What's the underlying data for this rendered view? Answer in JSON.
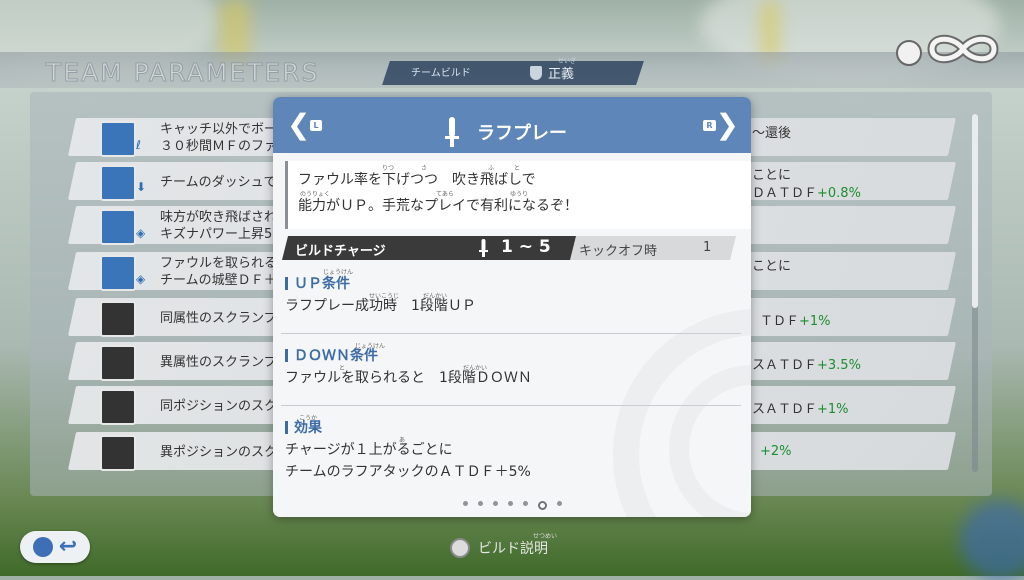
{
  "screen_title": "TEAM PARAMETERS",
  "tabs": {
    "build_tab": "チームビルド",
    "active_tab": "正義",
    "active_tab_ruby": "せいぎ"
  },
  "stat_rows": [
    {
      "text1": "キャッチ以外でボー",
      "text2": "３０秒間ＭＦのファ",
      "right": "〜還後",
      "right_green": ""
    },
    {
      "text1": "チームのダッシュで",
      "text2": "",
      "right": "ことに",
      "right2": "ＤＡＴＤＦ",
      "right_green": "+0.8%"
    },
    {
      "text1": "味方が吹き飛ばされ",
      "text2": "キズナパワー上昇5",
      "right": "",
      "right_green": ""
    },
    {
      "text1": "ファウルを取られる",
      "text2": "チームの城壁ＤＦ＋",
      "right": "ことに",
      "right_green": ""
    },
    {
      "text1": "同属性のスクランブ",
      "text2": "",
      "right": "ＴＤＦ",
      "right_green": "+1%"
    },
    {
      "text1": "異属性のスクランブ",
      "text2": "",
      "right": "スＡＴＤＦ",
      "right_green": "+3.5%"
    },
    {
      "text1": "同ポジションのスク",
      "text2": "",
      "right": "スＡＴＤＦ",
      "right_green": "+1%"
    },
    {
      "text1": "異ポジションのスク",
      "text2": "",
      "right": "",
      "right_green": "+2%"
    }
  ],
  "modal": {
    "title": "ラフプレー",
    "prev_button_tag": "L",
    "next_button_tag": "R",
    "description_line1": "ファウル率を下げつつ　吹き飛ばしで",
    "description_line2": "能力がＵＰ。手荒なプレイで有利になるぞ！",
    "ruby": {
      "ritsu": "りつ",
      "sa": "さ",
      "fu": "ふ",
      "tobu": "と",
      "nouryoku": "のうりょく",
      "tearai": "てあら",
      "yuuri": "ゆうり",
      "jouken": "じょうけん",
      "seikouji": "せいこうじ",
      "dankai": "だんかい",
      "to": "と",
      "kouka": "こうか",
      "a": "あ"
    },
    "charge_label": "ビルドチャージ",
    "charge_range": "1 ~ 5",
    "kickoff_label": "キックオフ時",
    "kickoff_value": "1",
    "sections": [
      {
        "heading": "ＵＰ条件",
        "body1": "ラフプレー成功時　1段階ＵＰ",
        "body2": ""
      },
      {
        "heading": "ＤＯＷＮ条件",
        "body1": "ファウルを取られると　1段階ＤＯＷＮ",
        "body2": ""
      },
      {
        "heading": "効果",
        "body1": "チャージが１上がるごとに",
        "body2": "チームのラフアタックのＡＴＤＦ＋5%"
      }
    ],
    "page_count": 7,
    "active_page": 6
  },
  "footer": {
    "build_help_label": "ビルド説明",
    "build_help_ruby": "せつめい"
  }
}
